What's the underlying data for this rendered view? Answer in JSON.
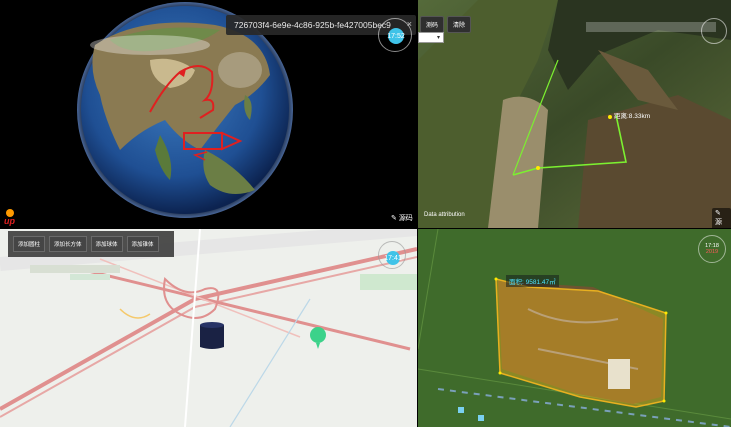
{
  "panel1": {
    "tooltip_text": "726703f4-6e9e-4c86-925b-fe427005bec9",
    "close_glyph": "×",
    "compass_time": "17:52",
    "source_label": "源码",
    "corner_logo": "up",
    "route_color": "#e02020"
  },
  "panel2": {
    "btn1": "测码",
    "btn2": "清除",
    "select_arrow": "▾",
    "distance_label": "距离:8.33km",
    "attribution": "Data attribution",
    "source_label": "源码",
    "path_color": "#7cf030"
  },
  "panel3": {
    "toolbar": [
      "添加圆柱",
      "添加长方体",
      "添加球体",
      "添加锥体"
    ],
    "compass_time": "17:41",
    "road_color": "#e0908f"
  },
  "panel4": {
    "area_label": "面积: 9581.47㎡",
    "clock_time": "17:18",
    "clock_sub": "2019",
    "polygon_color": "#e8b020"
  }
}
